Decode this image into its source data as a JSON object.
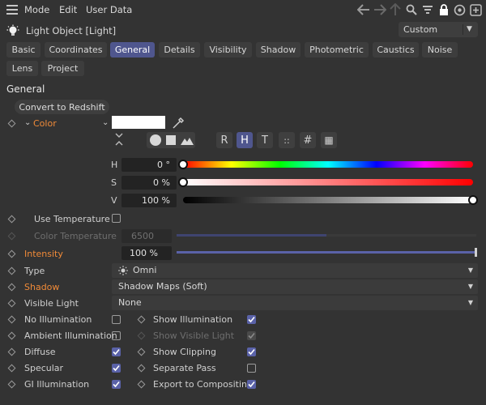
{
  "menu": {
    "items": [
      "Mode",
      "Edit",
      "User Data"
    ]
  },
  "header": {
    "title": "Light Object [Light]",
    "preset": "Custom"
  },
  "tabs": [
    {
      "label": "Basic",
      "active": false
    },
    {
      "label": "Coordinates",
      "active": false
    },
    {
      "label": "General",
      "active": true
    },
    {
      "label": "Details",
      "active": false
    },
    {
      "label": "Visibility",
      "active": false
    },
    {
      "label": "Shadow",
      "active": false
    },
    {
      "label": "Photometric",
      "active": false
    },
    {
      "label": "Caustics",
      "active": false
    },
    {
      "label": "Noise",
      "active": false
    },
    {
      "label": "Lens",
      "active": false
    },
    {
      "label": "Project",
      "active": false
    }
  ],
  "section": {
    "title": "General",
    "convert_button": "Convert to Redshift"
  },
  "color": {
    "label": "Color",
    "swatch": "#ffffff",
    "modes": [
      "R",
      "H",
      "T",
      "::",
      "#",
      "▦"
    ],
    "active_mode": "H",
    "h": {
      "label": "H",
      "value": "0 °",
      "fraction": 0.0
    },
    "s": {
      "label": "S",
      "value": "0 %",
      "fraction": 0.0
    },
    "v": {
      "label": "V",
      "value": "100 %",
      "fraction": 1.0
    }
  },
  "use_temperature": {
    "label": "Use Temperature",
    "checked": false
  },
  "color_temperature": {
    "label": "Color Temperature",
    "value": "6500",
    "fraction": 0.5
  },
  "intensity": {
    "label": "Intensity",
    "value": "100 %",
    "fraction": 1.0
  },
  "type": {
    "label": "Type",
    "value": "Omni"
  },
  "shadow": {
    "label": "Shadow",
    "value": "Shadow Maps (Soft)"
  },
  "visible_light": {
    "label": "Visible Light",
    "value": "None"
  },
  "checks_left": [
    {
      "label": "No Illumination",
      "checked": false
    },
    {
      "label": "Ambient Illumination",
      "checked": false
    },
    {
      "label": "Diffuse",
      "checked": true
    },
    {
      "label": "Specular",
      "checked": true
    },
    {
      "label": "GI Illumination",
      "checked": true
    }
  ],
  "checks_right": [
    {
      "label": "Show Illumination",
      "checked": true,
      "disabled": false
    },
    {
      "label": "Show Visible Light",
      "checked": true,
      "disabled": true
    },
    {
      "label": "Show Clipping",
      "checked": true,
      "disabled": false
    },
    {
      "label": "Separate Pass",
      "checked": false,
      "disabled": false
    },
    {
      "label": "Export to Compositing",
      "checked": true,
      "disabled": false
    }
  ],
  "colors": {
    "background": "#333333",
    "accent": "#4f568e",
    "orange_label": "#f08a38",
    "checkbox_on": "#5a62a8"
  },
  "icons": [
    "hamburger-icon",
    "arrow-left-icon",
    "arrow-right-icon",
    "arrow-up-icon",
    "search-icon",
    "filter-icon",
    "lock-icon",
    "target-icon",
    "add-icon",
    "light-bulb-icon",
    "eyedropper-icon",
    "omni-light-icon"
  ]
}
